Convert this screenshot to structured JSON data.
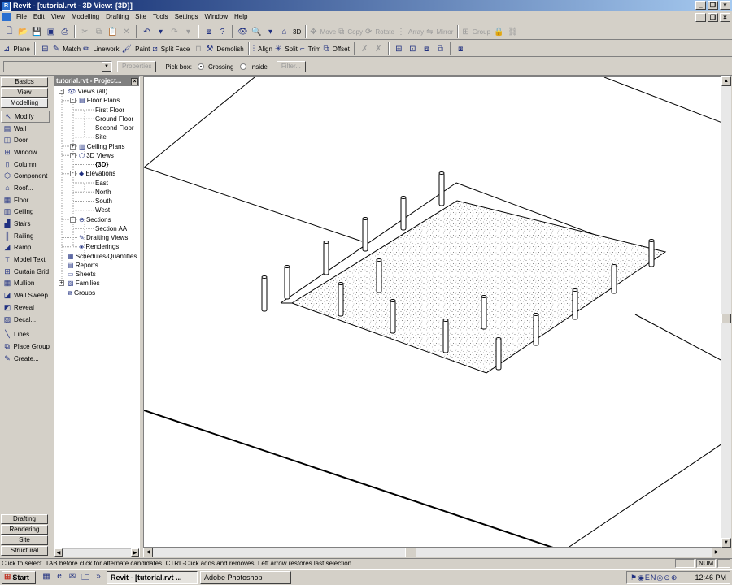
{
  "window": {
    "title": "Revit - [tutorial.rvt - 3D View: {3D}]"
  },
  "menu": [
    "File",
    "Edit",
    "View",
    "Modelling",
    "Drafting",
    "Site",
    "Tools",
    "Settings",
    "Window",
    "Help"
  ],
  "toolbar1": {
    "view3d": "3D",
    "move": "Move",
    "copy": "Copy",
    "rotate": "Rotate",
    "array": "Array",
    "mirror": "Mirror",
    "group": "Group"
  },
  "toolbar2": {
    "plane": "Plane",
    "match": "Match",
    "linework": "Linework",
    "paint": "Paint",
    "split_face": "Split Face",
    "demolish": "Demolish",
    "align": "Align",
    "split": "Split",
    "trim": "Trim",
    "offset": "Offset"
  },
  "optionsbar": {
    "type_selector_value": "",
    "properties": "Properties",
    "pick_box": "Pick box:",
    "crossing": "Crossing",
    "inside": "Inside",
    "filter": "Filter..."
  },
  "design_bar": {
    "top_tabs": [
      "Basics",
      "View",
      "Modelling"
    ],
    "tools": [
      {
        "label": "Modify",
        "icon": "arrow"
      },
      {
        "label": "Wall",
        "icon": "wall"
      },
      {
        "label": "Door",
        "icon": "door"
      },
      {
        "label": "Window",
        "icon": "window"
      },
      {
        "label": "Column",
        "icon": "column"
      },
      {
        "label": "Component",
        "icon": "component"
      },
      {
        "label": "Roof...",
        "icon": "roof"
      },
      {
        "label": "Floor",
        "icon": "floor"
      },
      {
        "label": "Ceiling",
        "icon": "ceiling"
      },
      {
        "label": "Stairs",
        "icon": "stairs"
      },
      {
        "label": "Railing",
        "icon": "railing"
      },
      {
        "label": "Ramp",
        "icon": "ramp"
      },
      {
        "label": "Model Text",
        "icon": "text"
      },
      {
        "label": "Curtain Grid",
        "icon": "grid"
      },
      {
        "label": "Mullion",
        "icon": "mullion"
      },
      {
        "label": "Wall Sweep",
        "icon": "sweep"
      },
      {
        "label": "Reveal",
        "icon": "reveal"
      },
      {
        "label": "Decal...",
        "icon": "decal"
      },
      {
        "label": "Lines",
        "icon": "lines"
      },
      {
        "label": "Place Group",
        "icon": "group"
      },
      {
        "label": "Create...",
        "icon": "create"
      }
    ],
    "bottom_tabs": [
      "Drafting",
      "Rendering",
      "Site",
      "Structural"
    ]
  },
  "project_browser": {
    "title": "tutorial.rvt - Project...",
    "nodes": [
      {
        "label": "Views (all)",
        "indent": 0,
        "exp": "-"
      },
      {
        "label": "Floor Plans",
        "indent": 1,
        "exp": "-"
      },
      {
        "label": "First Floor",
        "indent": 2,
        "exp": ""
      },
      {
        "label": "Ground Floor",
        "indent": 2,
        "exp": ""
      },
      {
        "label": "Second Floor",
        "indent": 2,
        "exp": ""
      },
      {
        "label": "Site",
        "indent": 2,
        "exp": ""
      },
      {
        "label": "Ceiling Plans",
        "indent": 1,
        "exp": "+"
      },
      {
        "label": "3D Views",
        "indent": 1,
        "exp": "-"
      },
      {
        "label": "{3D}",
        "indent": 2,
        "exp": "",
        "bold": true
      },
      {
        "label": "Elevations",
        "indent": 1,
        "exp": "-"
      },
      {
        "label": "East",
        "indent": 2,
        "exp": ""
      },
      {
        "label": "North",
        "indent": 2,
        "exp": ""
      },
      {
        "label": "South",
        "indent": 2,
        "exp": ""
      },
      {
        "label": "West",
        "indent": 2,
        "exp": ""
      },
      {
        "label": "Sections",
        "indent": 1,
        "exp": "-"
      },
      {
        "label": "Section AA",
        "indent": 2,
        "exp": ""
      },
      {
        "label": "Drafting Views",
        "indent": 1,
        "exp": ""
      },
      {
        "label": "Renderings",
        "indent": 1,
        "exp": ""
      },
      {
        "label": "Schedules/Quantities",
        "indent": 0,
        "exp": ""
      },
      {
        "label": "Reports",
        "indent": 0,
        "exp": ""
      },
      {
        "label": "Sheets",
        "indent": 0,
        "exp": ""
      },
      {
        "label": "Families",
        "indent": 0,
        "exp": "+"
      },
      {
        "label": "Groups",
        "indent": 0,
        "exp": ""
      }
    ]
  },
  "status": {
    "message": "Click to select. TAB before click for alternate candidates. CTRL-Click adds and removes. Left arrow restores last selection.",
    "num": "NUM"
  },
  "taskbar": {
    "start": "Start",
    "tasks": [
      "Revit - [tutorial.rvt ...",
      "Adobe Photoshop"
    ],
    "time": "12:46 PM"
  }
}
